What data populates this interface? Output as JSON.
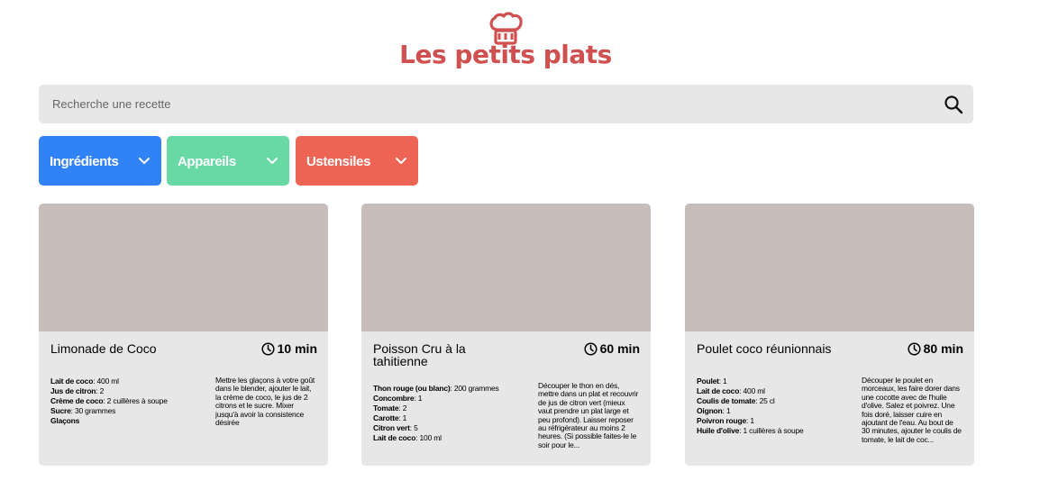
{
  "header": {
    "title": "Les petits plats",
    "logo_icon": "chef-hat-icon",
    "brand_color": "#D04F4F"
  },
  "search": {
    "placeholder": "Recherche une recette",
    "icon": "search-icon"
  },
  "filters": [
    {
      "label": "Ingrédients",
      "color": "#3282F7"
    },
    {
      "label": "Appareils",
      "color": "#68D9A4"
    },
    {
      "label": "Ustensiles",
      "color": "#ED6454"
    }
  ],
  "recipes": [
    {
      "name": "Limonade de Coco",
      "time": "10 min",
      "ingredients": [
        {
          "ingredient": "Lait de coco",
          "quantity": ": 400 ml"
        },
        {
          "ingredient": "Jus de citron",
          "quantity": ": 2"
        },
        {
          "ingredient": "Crème de coco",
          "quantity": ": 2 cuillères à soupe"
        },
        {
          "ingredient": "Sucre",
          "quantity": ": 30 grammes"
        },
        {
          "ingredient": "Glaçons",
          "quantity": ""
        }
      ],
      "description": "Mettre les glaçons à votre goût dans le blender, ajouter le lait, la crème de coco, le jus de 2 citrons et le sucre. Mixer jusqu'à avoir la consistence désirée"
    },
    {
      "name": "Poisson Cru à la tahitienne",
      "time": "60 min",
      "ingredients": [
        {
          "ingredient": "Thon rouge (ou blanc)",
          "quantity": ": 200 grammes"
        },
        {
          "ingredient": "Concombre",
          "quantity": ": 1"
        },
        {
          "ingredient": "Tomate",
          "quantity": ": 2"
        },
        {
          "ingredient": "Carotte",
          "quantity": ": 1"
        },
        {
          "ingredient": "Citron vert",
          "quantity": ": 5"
        },
        {
          "ingredient": "Lait de coco",
          "quantity": ": 100 ml"
        }
      ],
      "description": "Découper le thon en dés, mettre dans un plat et recouvrir de jus de citron vert (mieux vaut prendre un plat large et peu profond). Laisser reposer au réfrigérateur au moins 2 heures. (Si possible faites-le le soir pour le..."
    },
    {
      "name": "Poulet coco réunionnais",
      "time": "80 min",
      "ingredients": [
        {
          "ingredient": "Poulet",
          "quantity": ": 1"
        },
        {
          "ingredient": "Lait de coco",
          "quantity": ": 400 ml"
        },
        {
          "ingredient": "Coulis de tomate",
          "quantity": ": 25 cl"
        },
        {
          "ingredient": "Oignon",
          "quantity": ": 1"
        },
        {
          "ingredient": "Poivron rouge",
          "quantity": ": 1"
        },
        {
          "ingredient": "Huile d'olive",
          "quantity": ": 1 cuillères à soupe"
        }
      ],
      "description": "Découper le poulet en morceaux, les faire dorer dans une cocotte avec de l'huile d'olive. Salez et poivrez. Une fois doré, laisser cuire en ajoutant de l'eau. Au bout de 30 minutes, ajouter le coulis de tomate, le lait de coc..."
    }
  ]
}
